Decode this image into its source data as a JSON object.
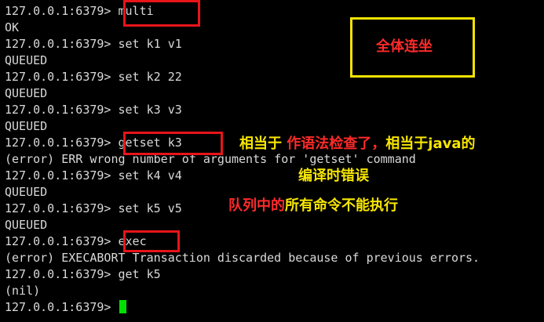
{
  "terminal": {
    "lines": [
      "127.0.0.1:6379> multi",
      "OK",
      "127.0.0.1:6379> set k1 v1",
      "QUEUED",
      "127.0.0.1:6379> set k2 22",
      "QUEUED",
      "127.0.0.1:6379> set k3 v3",
      "QUEUED",
      "127.0.0.1:6379> getset k3",
      "(error) ERR wrong number of arguments for 'getset' command",
      "127.0.0.1:6379> set k4 v4",
      "QUEUED",
      "127.0.0.1:6379> set k5 v5",
      "QUEUED",
      "127.0.0.1:6379> exec",
      "(error) EXECABORT Transaction discarded because of previous errors.",
      "127.0.0.1:6379> get k5",
      "(nil)",
      "127.0.0.1:6379> "
    ],
    "cursor_color": "#00e000"
  },
  "annotations": {
    "title": "全体连坐",
    "note1_part1": "相当于 ",
    "note1_part2": "作语法检查了，",
    "note1_part3": "相当于java的",
    "note1_line2": "编译时错误",
    "note2_part1": "队列中的",
    "note2_part2": "所有命令不能执行"
  },
  "colors": {
    "background": "#000000",
    "text": "#d9d9d9",
    "highlight_red": "#e8141a",
    "highlight_yellow": "#f3e400"
  }
}
